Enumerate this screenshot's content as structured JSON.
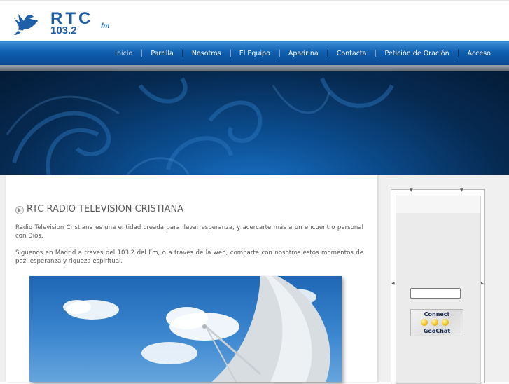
{
  "brand": {
    "logo_text": "RTC",
    "logo_freq": "103.2",
    "logo_unit": "fm",
    "colors": {
      "primary": "#1f5fa8",
      "nav": "#0f5fb0"
    }
  },
  "nav": {
    "items": [
      {
        "label": "Inicio",
        "active": true
      },
      {
        "label": "Parrilla"
      },
      {
        "label": "Nosotros"
      },
      {
        "label": "El Equipo"
      },
      {
        "label": "Apadrina"
      },
      {
        "label": "Contacta"
      },
      {
        "label": "Petición de Oración"
      },
      {
        "label": "Acceso"
      }
    ]
  },
  "main": {
    "title": "RTC RADIO TELEVISION CRISTIANA",
    "paragraph1": "Radio Television Cristiana es una entidad creada para llevar esperanza, y acercarte más a un encuentro personal con Dios.",
    "paragraph2": "Siguenos en Madrid a traves del 103.2 del Fm, o a traves de la web, comparte con nosotros estos momentos de paz, esperanza y riqueza espiritual."
  },
  "chat": {
    "button_line1": "Connect",
    "button_line2": "GeoChat",
    "input_value": ""
  }
}
